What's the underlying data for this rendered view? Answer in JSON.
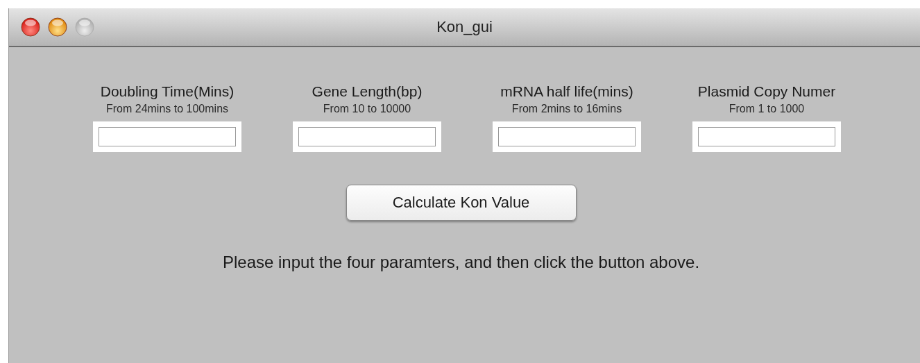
{
  "window": {
    "title": "Kon_gui",
    "controls": [
      {
        "kind": "close",
        "disabled": false
      },
      {
        "kind": "minimize",
        "disabled": false
      },
      {
        "kind": "zoom",
        "disabled": true
      }
    ]
  },
  "fields": [
    {
      "label": "Doubling Time(Mins)",
      "hint": "From 24mins to 100mins"
    },
    {
      "label": "Gene Length(bp)",
      "hint": "From 10 to 10000"
    },
    {
      "label": "mRNA half life(mins)",
      "hint": "From 2mins to 16mins"
    },
    {
      "label": "Plasmid Copy Numer",
      "hint": "From 1 to 1000"
    }
  ],
  "button": "Calculate Kon Value",
  "message": "Please input the four paramters, and then click the button above."
}
